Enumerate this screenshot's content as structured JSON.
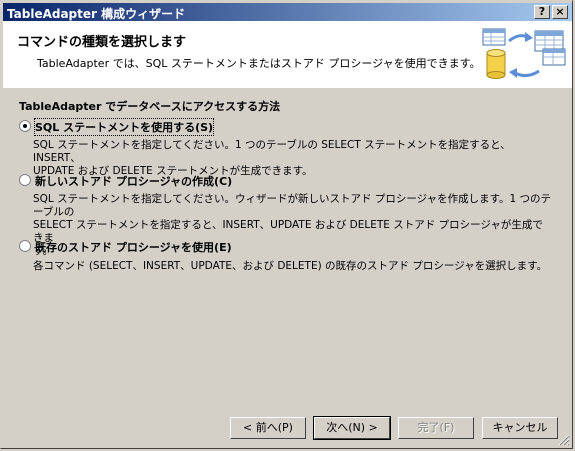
{
  "window": {
    "title": "TableAdapter 構成ウィザード",
    "help_button": "?",
    "close_button": "×"
  },
  "header": {
    "title": "コマンドの種類を選択します",
    "subtitle": "TableAdapter では、SQL ステートメントまたはストアド プロシージャを使用できます。",
    "art_icon": "database-table-sync-icon"
  },
  "group_label": "TableAdapter でデータベースにアクセスする方法",
  "options": [
    {
      "label": "SQL ステートメントを使用する(S)",
      "selected": true,
      "description_lines": [
        "SQL ステートメントを指定してください。1 つのテーブルの SELECT ステートメントを指定すると、INSERT、",
        "UPDATE および DELETE ステートメントが生成できます。"
      ]
    },
    {
      "label": "新しいストアド プロシージャの作成(C)",
      "selected": false,
      "description_lines": [
        "SQL ステートメントを指定してください。ウィザードが新しいストアド プロシージャを作成します。1 つのテーブルの",
        "SELECT ステートメントを指定すると、INSERT、UPDATE および DELETE ストアド プロシージャが生成できま",
        "す。"
      ]
    },
    {
      "label": "既存のストアド プロシージャを使用(E)",
      "selected": false,
      "description_lines": [
        "各コマンド (SELECT、INSERT、UPDATE、および DELETE) の既存のストアド プロシージャを選択します。"
      ]
    }
  ],
  "buttons": {
    "back": "< 前へ(P)",
    "next": "次へ(N) >",
    "finish": "完了(F)",
    "cancel": "キャンセル"
  },
  "colors": {
    "title_bar_start": "#0a246a",
    "title_bar_end": "#a6caf0",
    "dialog_bg": "#d4d0c8"
  }
}
